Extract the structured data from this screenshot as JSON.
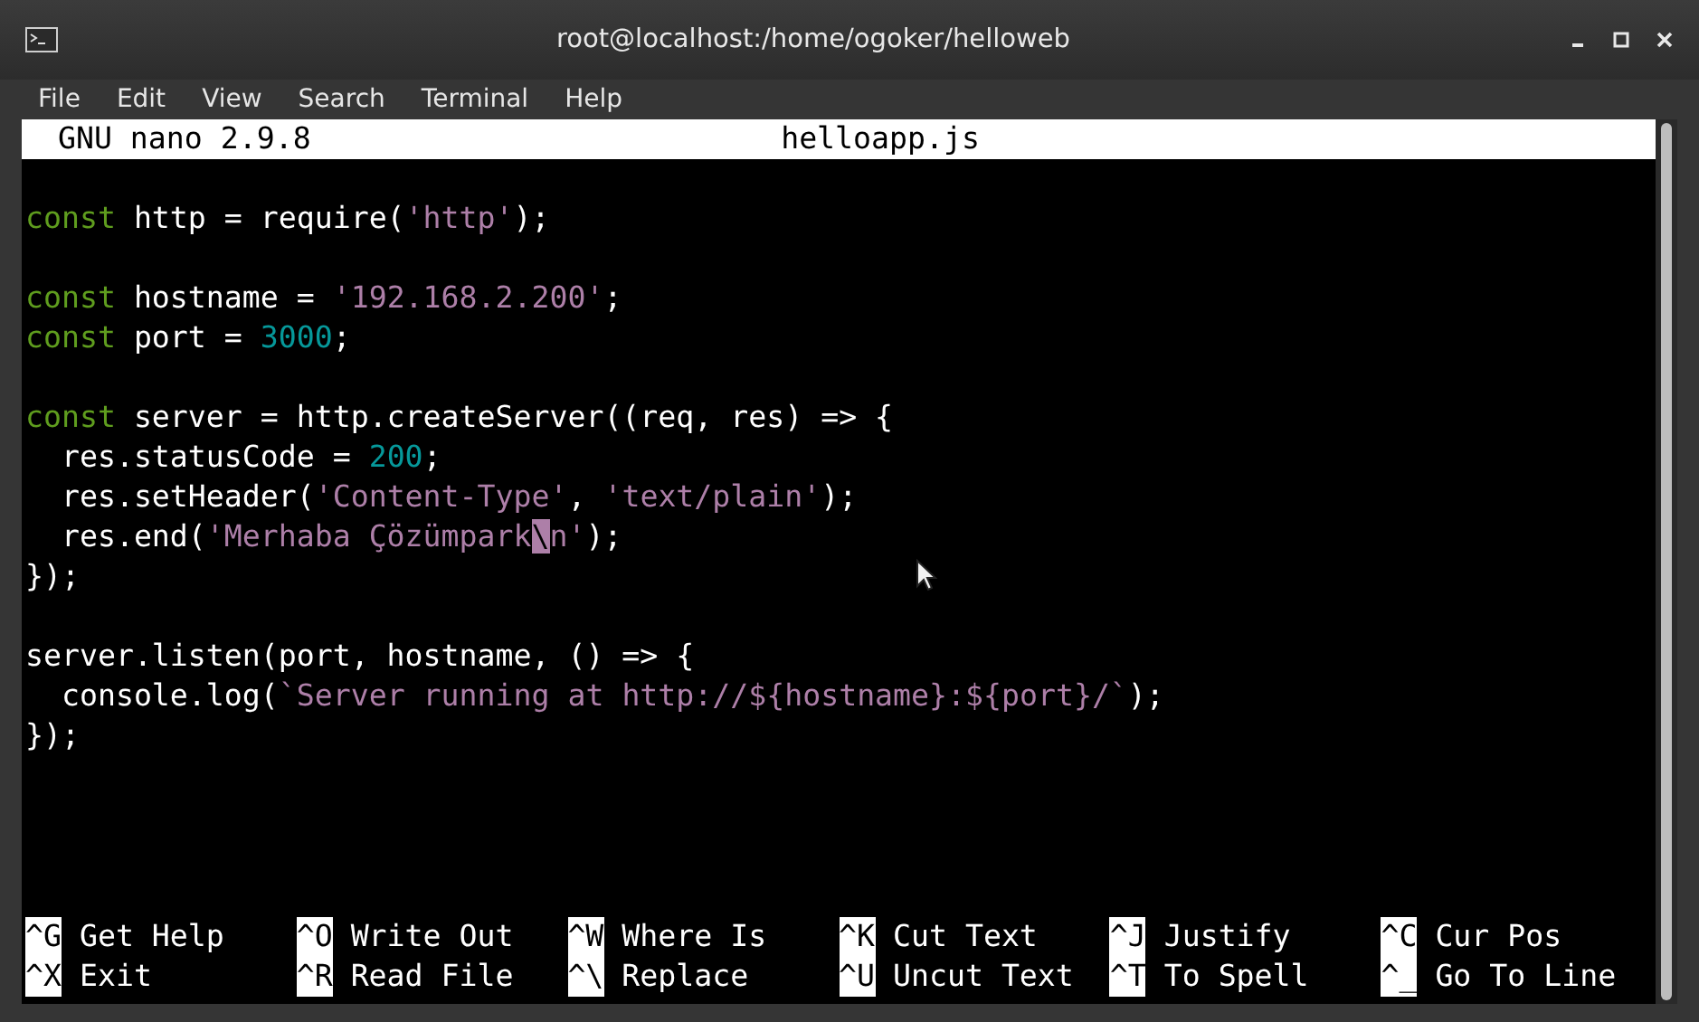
{
  "window": {
    "title": "root@localhost:/home/ogoker/helloweb"
  },
  "menu": [
    "File",
    "Edit",
    "View",
    "Search",
    "Terminal",
    "Help"
  ],
  "nano": {
    "version": "GNU nano 2.9.8",
    "filename": "helloapp.js"
  },
  "lines": [
    {
      "kind": "blank"
    },
    {
      "kind": "code",
      "tokens": [
        {
          "kind": "keyword",
          "text": "const"
        },
        {
          "kind": "plain",
          "text": " http = require("
        },
        {
          "kind": "string",
          "text": "'http'"
        },
        {
          "kind": "plain",
          "text": ");"
        }
      ]
    },
    {
      "kind": "blank"
    },
    {
      "kind": "code",
      "tokens": [
        {
          "kind": "keyword",
          "text": "const"
        },
        {
          "kind": "plain",
          "text": " hostname = "
        },
        {
          "kind": "string",
          "text": "'192.168.2.200'"
        },
        {
          "kind": "plain",
          "text": ";"
        }
      ]
    },
    {
      "kind": "code",
      "tokens": [
        {
          "kind": "keyword",
          "text": "const"
        },
        {
          "kind": "plain",
          "text": " port = "
        },
        {
          "kind": "number",
          "text": "3000"
        },
        {
          "kind": "plain",
          "text": ";"
        }
      ]
    },
    {
      "kind": "blank"
    },
    {
      "kind": "code",
      "tokens": [
        {
          "kind": "keyword",
          "text": "const"
        },
        {
          "kind": "plain",
          "text": " server = http.createServer((req, res) => {"
        }
      ]
    },
    {
      "kind": "code",
      "tokens": [
        {
          "kind": "plain",
          "text": "  res.statusCode = "
        },
        {
          "kind": "number",
          "text": "200"
        },
        {
          "kind": "plain",
          "text": ";"
        }
      ]
    },
    {
      "kind": "code",
      "tokens": [
        {
          "kind": "plain",
          "text": "  res.setHeader("
        },
        {
          "kind": "string",
          "text": "'Content-Type'"
        },
        {
          "kind": "plain",
          "text": ", "
        },
        {
          "kind": "string",
          "text": "'text/plain'"
        },
        {
          "kind": "plain",
          "text": ");"
        }
      ]
    },
    {
      "kind": "code",
      "tokens": [
        {
          "kind": "plain",
          "text": "  res.end("
        },
        {
          "kind": "string",
          "text": "'Merhaba Çözümpark"
        },
        {
          "kind": "cursor",
          "text": "\\"
        },
        {
          "kind": "string",
          "text": "n'"
        },
        {
          "kind": "plain",
          "text": ");"
        }
      ]
    },
    {
      "kind": "code",
      "tokens": [
        {
          "kind": "plain",
          "text": "});"
        }
      ]
    },
    {
      "kind": "blank"
    },
    {
      "kind": "code",
      "tokens": [
        {
          "kind": "plain",
          "text": "server.listen(port, hostname, () => {"
        }
      ]
    },
    {
      "kind": "code",
      "tokens": [
        {
          "kind": "plain",
          "text": "  console.log("
        },
        {
          "kind": "string",
          "text": "`Server running at http://${hostname}:${port}/`"
        },
        {
          "kind": "plain",
          "text": ");"
        }
      ]
    },
    {
      "kind": "code",
      "tokens": [
        {
          "kind": "plain",
          "text": "});"
        }
      ]
    }
  ],
  "shortcuts": [
    {
      "key": "^G",
      "label": "Get Help"
    },
    {
      "key": "^O",
      "label": "Write Out"
    },
    {
      "key": "^W",
      "label": "Where Is"
    },
    {
      "key": "^K",
      "label": "Cut Text"
    },
    {
      "key": "^J",
      "label": "Justify"
    },
    {
      "key": "^C",
      "label": "Cur Pos"
    },
    {
      "key": "^X",
      "label": "Exit"
    },
    {
      "key": "^R",
      "label": "Read File"
    },
    {
      "key": "^\\",
      "label": "Replace"
    },
    {
      "key": "^U",
      "label": "Uncut Text"
    },
    {
      "key": "^T",
      "label": "To Spell"
    },
    {
      "key": "^_",
      "label": "Go To Line"
    }
  ]
}
